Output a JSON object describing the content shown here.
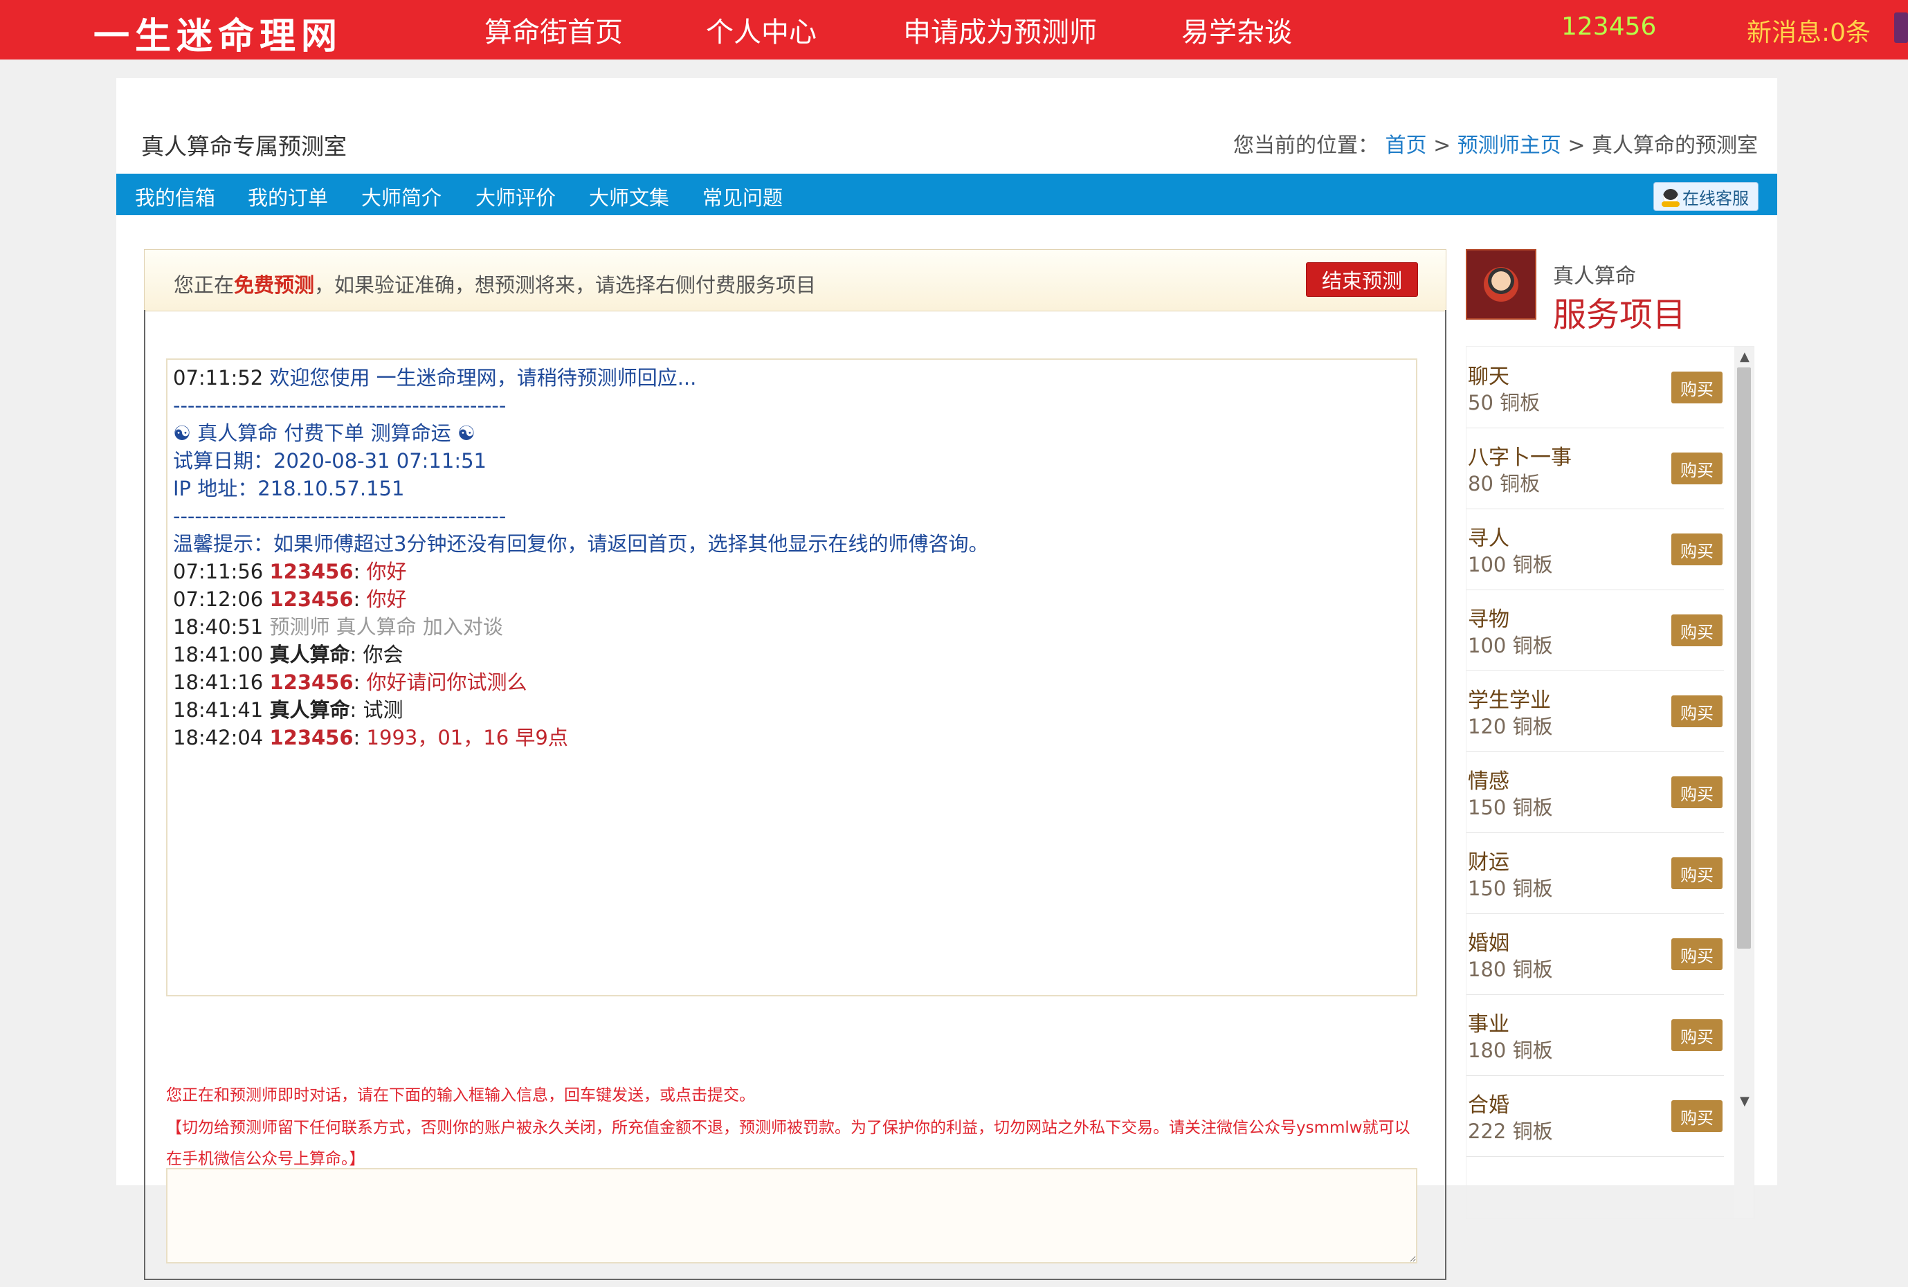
{
  "header": {
    "brand": "一生迷命理网",
    "nav": [
      "算命街首页",
      "个人中心",
      "申请成为预测师",
      "易学杂谈"
    ],
    "username": "123456",
    "messages": "新消息:0条"
  },
  "page": {
    "title": "真人算命专属预测室",
    "breadcrumb": {
      "prefix": "您当前的位置：",
      "home": "首页",
      "sep": ">",
      "master_home": "预测师主页",
      "current": "真人算命的预测室"
    }
  },
  "subnav": [
    "我的信箱",
    "我的订单",
    "大师简介",
    "大师评价",
    "大师文集",
    "常见问题"
  ],
  "support_label": "在线客服",
  "notice": {
    "prefix": "您正在",
    "highlight": "免费预测",
    "suffix": "，如果验证准确，想预测将来，请选择右侧付费服务项目",
    "end_button": "结束预测"
  },
  "chat": {
    "welcome_time": "07:11:52",
    "welcome_text": "欢迎您使用 一生迷命理网，请稍待预测师回应...",
    "divider": "----------------------------------------------",
    "order_line": "☯ 真人算命 付费下单 测算命运 ☯",
    "calc_date": "试算日期：2020-08-31 07:11:51",
    "ip": "IP 地址：218.10.57.151",
    "tip": "温馨提示：如果师傅超过3分钟还没有回复你，请返回首页，选择其他显示在线的师傅咨询。",
    "messages": [
      {
        "time": "07:11:56",
        "user": "123456",
        "text": "你好"
      },
      {
        "time": "07:12:06",
        "user": "123456",
        "text": "你好"
      },
      {
        "time": "18:40:51",
        "text": "预测师 真人算命 加入对谈"
      },
      {
        "time": "18:41:00",
        "user": "真人算命",
        "text": "你会"
      },
      {
        "time": "18:41:16",
        "user": "123456",
        "text": "你好请问你试测么"
      },
      {
        "time": "18:41:41",
        "user": "真人算命",
        "text": "试测"
      },
      {
        "time": "18:42:04",
        "user": "123456",
        "text": "1993，01，16 早9点"
      }
    ]
  },
  "warnings": {
    "line1": "您正在和预测师即时对话，请在下面的输入框输入信息，回车键发送，或点击提交。",
    "line2": "【切勿给预测师留下任何联系方式，否则你的账户被永久关闭，所充值金额不退，预测师被罚款。为了保护你的利益，切勿网站之外私下交易。请关注微信公众号ysmmlw就可以在手机微信公众号上算命。】"
  },
  "sidebar": {
    "master_name": "真人算命",
    "service_title": "服务项目",
    "buy_label": "购买",
    "services": [
      {
        "name": "聊天",
        "price": "50 铜板"
      },
      {
        "name": "八字卜一事",
        "price": "80 铜板"
      },
      {
        "name": "寻人",
        "price": "100 铜板"
      },
      {
        "name": "寻物",
        "price": "100 铜板"
      },
      {
        "name": "学生学业",
        "price": "120 铜板"
      },
      {
        "name": "情感",
        "price": "150 铜板"
      },
      {
        "name": "财运",
        "price": "150 铜板"
      },
      {
        "name": "婚姻",
        "price": "180 铜板"
      },
      {
        "name": "事业",
        "price": "180 铜板"
      },
      {
        "name": "合婚",
        "price": "222 铜板"
      }
    ]
  }
}
